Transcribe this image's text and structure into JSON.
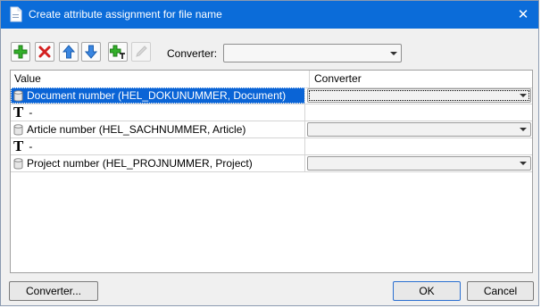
{
  "window": {
    "title": "Create attribute assignment for file name",
    "close_glyph": "✕"
  },
  "toolbar": {
    "buttons": [
      {
        "icon": "add-icon"
      },
      {
        "icon": "delete-icon"
      },
      {
        "icon": "move-up-icon"
      },
      {
        "icon": "move-down-icon"
      },
      {
        "icon": "add-text-icon"
      },
      {
        "icon": "edit-icon",
        "disabled": true
      }
    ],
    "converter_label": "Converter:",
    "converter_value": ""
  },
  "grid": {
    "columns": [
      "Value",
      "Converter"
    ],
    "rows": [
      {
        "type": "attribute",
        "value": "Document number (HEL_DOKUNUMMER, Document)",
        "converter": "",
        "selected": true
      },
      {
        "type": "text",
        "value": "-",
        "converter": ""
      },
      {
        "type": "attribute",
        "value": "Article number (HEL_SACHNUMMER, Article)",
        "converter": ""
      },
      {
        "type": "text",
        "value": "-",
        "converter": ""
      },
      {
        "type": "attribute",
        "value": "Project number (HEL_PROJNUMMER, Project)",
        "converter": ""
      }
    ],
    "text_glyph": "T"
  },
  "buttons": {
    "converter": "Converter...",
    "ok": "OK",
    "cancel": "Cancel"
  },
  "colors": {
    "titlebar": "#0b6cd9",
    "selection": "#0a64d6",
    "dialog_bg": "#f0f0f0"
  }
}
